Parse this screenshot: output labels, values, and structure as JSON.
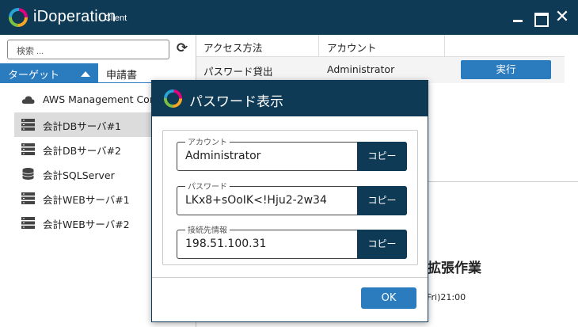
{
  "app": {
    "name": "iDoperation",
    "subtitle": "Client"
  },
  "window": {
    "minimize_icon": "minimize-icon",
    "maximize_icon": "maximize-icon",
    "close_label": "✕"
  },
  "sidebar": {
    "search_placeholder": "検索 ...",
    "refresh_icon": "⟳",
    "tabs": [
      {
        "label": "ターゲット",
        "active": true
      },
      {
        "label": "申請書",
        "active": false
      }
    ],
    "items": [
      {
        "label": "AWS Management Console",
        "icon": "cloud-icon",
        "selected": false
      },
      {
        "label": "会計DBサーバ#1",
        "icon": "server-icon",
        "selected": true
      },
      {
        "label": "会計DBサーバ#2",
        "icon": "server-icon",
        "selected": false
      },
      {
        "label": "会計SQLServer",
        "icon": "database-icon",
        "selected": false
      },
      {
        "label": "会計WEBサーバ#1",
        "icon": "server-icon",
        "selected": false
      },
      {
        "label": "会計WEBサーバ#2",
        "icon": "server-icon",
        "selected": false
      }
    ]
  },
  "main": {
    "columns": [
      "アクセス方法",
      "アカウント"
    ],
    "rows": [
      {
        "method": "パスワード貸出",
        "account": "Administrator",
        "action": "実行"
      }
    ],
    "background_title": "拡張作業",
    "background_date": "Fri)21:00"
  },
  "dialog": {
    "title": "パスワード表示",
    "fields": [
      {
        "legend": "アカウント",
        "value": "Administrator",
        "copy": "コピー"
      },
      {
        "legend": "パスワード",
        "value": "LKx8+sOoIK<!Hju2-2w34",
        "copy": "コピー"
      },
      {
        "legend": "接続先情報",
        "value": "198.51.100.31",
        "copy": "コピー"
      }
    ],
    "ok_label": "OK"
  },
  "colors": {
    "titlebar": "#0e3a55",
    "accent": "#2b7bbf",
    "selected_row": "#dcdcdc"
  }
}
